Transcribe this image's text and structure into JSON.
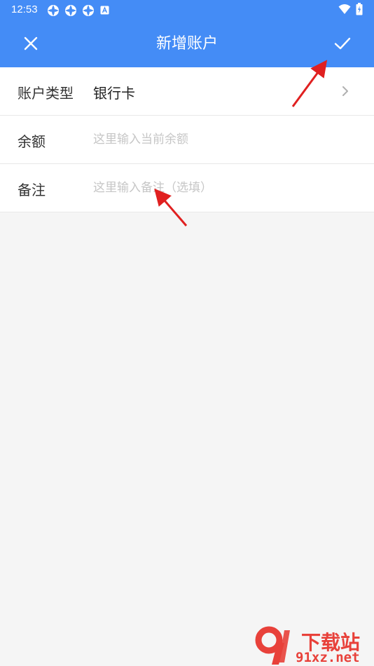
{
  "status_bar": {
    "time": "12:53",
    "notification_icons": [
      "sync-icon",
      "sync-icon",
      "sync-icon",
      "a-icon"
    ],
    "right_icons": [
      "wifi-icon",
      "battery-icon"
    ]
  },
  "app_bar": {
    "title": "新增账户",
    "close_icon": "close-icon",
    "confirm_icon": "check-icon",
    "color": "#448cf6"
  },
  "form": {
    "account_type": {
      "label": "账户类型",
      "value": "银行卡"
    },
    "balance": {
      "label": "余额",
      "placeholder": "这里输入当前余额",
      "value": ""
    },
    "note": {
      "label": "备注",
      "placeholder": "这里输入备注（选填）",
      "value": ""
    }
  },
  "watermark": {
    "logo_text": "91",
    "title": "下载站",
    "url": "91xz.net",
    "color": "#e8413a"
  },
  "annotation_color": "#e02020"
}
